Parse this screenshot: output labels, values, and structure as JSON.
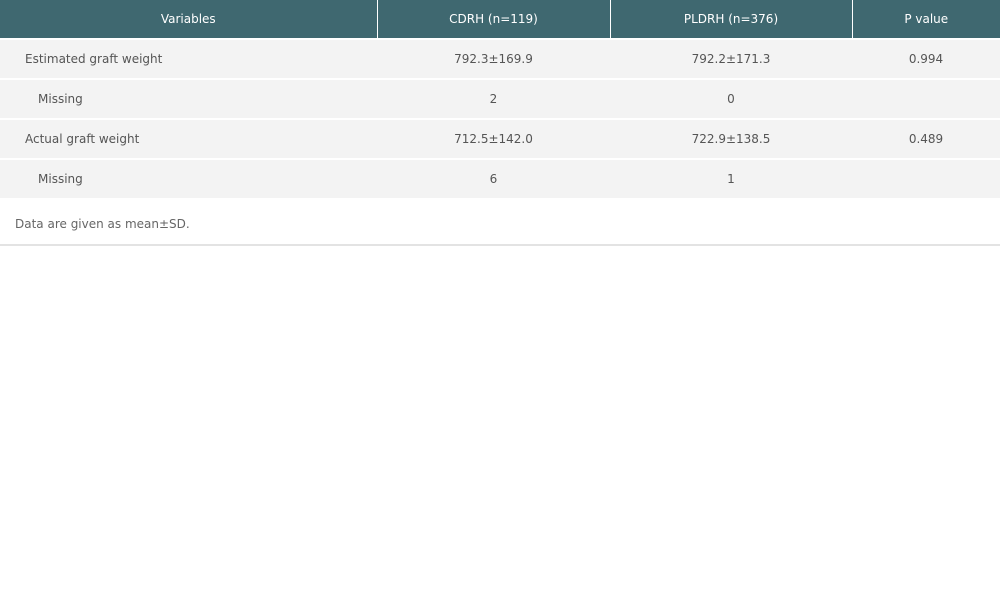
{
  "table": {
    "headers": [
      "Variables",
      "CDRH (n=119)",
      "PLDRH (n=376)",
      "P value"
    ],
    "rows": [
      {
        "variable": "Estimated graft weight",
        "cdrh": "792.3±169.9",
        "pldrh": "792.2±171.3",
        "p": "0.994"
      },
      {
        "variable": "Missing",
        "cdrh": "2",
        "pldrh": "0",
        "p": ""
      },
      {
        "variable": "Actual graft weight",
        "cdrh": "712.5±142.0",
        "pldrh": "722.9±138.5",
        "p": "0.489"
      },
      {
        "variable": "Missing",
        "cdrh": "6",
        "pldrh": "1",
        "p": ""
      }
    ]
  },
  "footnote": "Data are given as mean±SD."
}
